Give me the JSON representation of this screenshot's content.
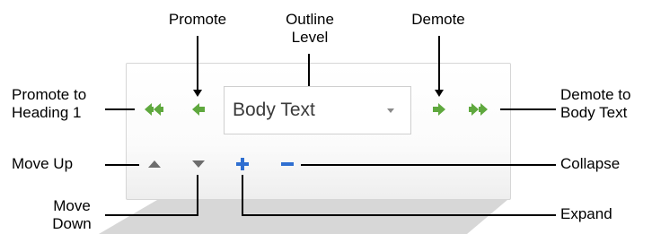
{
  "outline_toolbar": {
    "outline_level_value": "Body Text"
  },
  "callouts": {
    "promote": [
      "Promote"
    ],
    "outline_level": [
      "Outline",
      "Level"
    ],
    "demote": [
      "Demote"
    ],
    "promote_to_heading1": [
      "Promote to",
      "Heading 1"
    ],
    "demote_to_body_text": [
      "Demote to",
      "Body Text"
    ],
    "move_up": [
      "Move Up"
    ],
    "collapse": [
      "Collapse"
    ],
    "move_down": [
      "Move",
      "Down"
    ],
    "expand": [
      "Expand"
    ]
  },
  "colors": {
    "arrow_green": "#5fa83e",
    "plus_blue": "#2f6fd1",
    "move_gray": "#6d6d6d"
  }
}
